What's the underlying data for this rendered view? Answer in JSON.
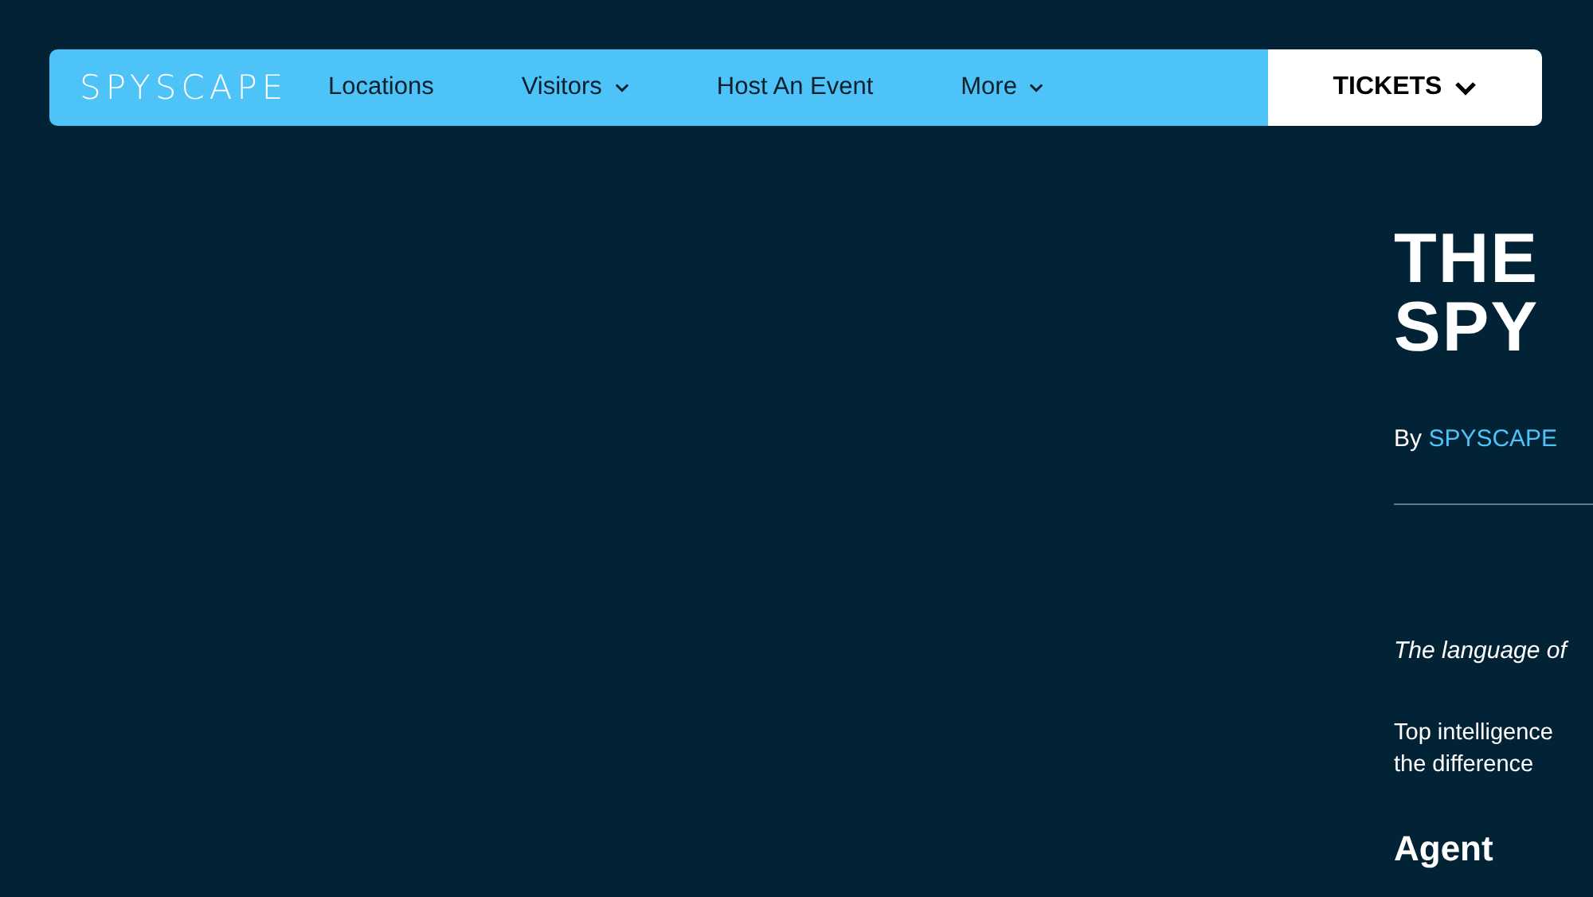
{
  "nav": {
    "logo": "SPYSCAPE",
    "items": [
      {
        "label": "Locations",
        "dropdown": false
      },
      {
        "label": "Visitors",
        "dropdown": true
      },
      {
        "label": "Host An Event",
        "dropdown": false
      },
      {
        "label": "More",
        "dropdown": true
      }
    ],
    "tickets_button": "TICKETS"
  },
  "article": {
    "title_lines": [
      "THE",
      "SPY"
    ],
    "byline_prefix": "By",
    "author": "SPYSCAPE",
    "intro": "The language of",
    "paragraph_lines": [
      "Top intelligence",
      "the difference"
    ],
    "subheading": "Agent"
  }
}
